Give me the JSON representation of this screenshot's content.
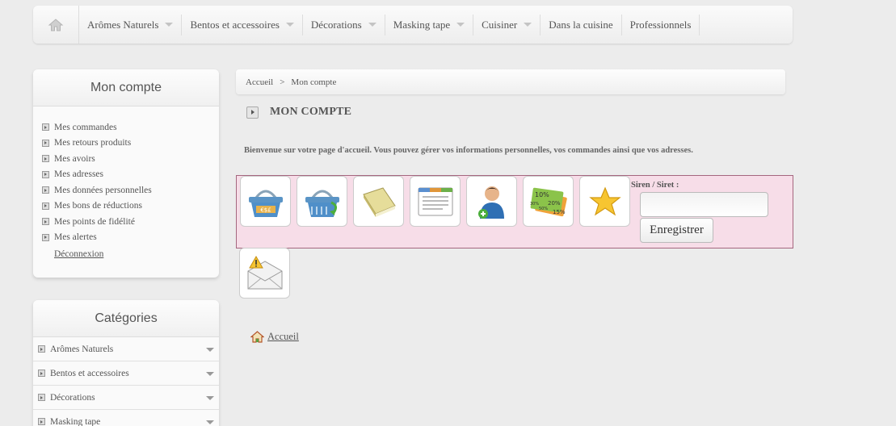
{
  "nav": {
    "home_icon": "home-icon",
    "items": [
      {
        "label": "Arômes Naturels",
        "has_dropdown": true
      },
      {
        "label": "Bentos et accessoires",
        "has_dropdown": true
      },
      {
        "label": "Décorations",
        "has_dropdown": true
      },
      {
        "label": "Masking tape",
        "has_dropdown": true
      },
      {
        "label": "Cuisiner",
        "has_dropdown": true
      },
      {
        "label": "Dans la cuisine",
        "has_dropdown": false
      },
      {
        "label": "Professionnels",
        "has_dropdown": false
      }
    ]
  },
  "account_block": {
    "title": "Mon compte",
    "links": [
      "Mes commandes",
      "Mes retours produits",
      "Mes avoirs",
      "Mes adresses",
      "Mes données personnelles",
      "Mes bons de réductions",
      "Mes points de fidélité",
      "Mes alertes"
    ],
    "logout": "Déconnexion"
  },
  "categories_block": {
    "title": "Catégories",
    "items": [
      "Arômes Naturels",
      "Bentos et accessoires",
      "Décorations",
      "Masking tape"
    ]
  },
  "breadcrumb": {
    "home": "Accueil",
    "separator": ">",
    "current": "Mon compte"
  },
  "page": {
    "title": "MON COMPTE",
    "welcome": "Bienvenue sur votre page d'accueil. Vous pouvez gérer vos informations personnelles, vos commandes ainsi que vos adresses."
  },
  "account_icons": [
    "basket-icon",
    "basket-return-icon",
    "book-icon",
    "address-card-icon",
    "user-add-icon",
    "discount-tags-icon",
    "star-icon",
    "alert-mail-icon"
  ],
  "discount_tags": [
    "10%",
    "20%",
    "30%",
    "50%",
    "15%"
  ],
  "siren": {
    "label": "Siren / Siret :",
    "value": "",
    "button": "Enregistrer"
  },
  "footer_link": {
    "label": "Accueil"
  },
  "colors": {
    "background": "#ececec",
    "icon_panel": "#f7dde8",
    "icon_panel_border": "#a5677f"
  }
}
